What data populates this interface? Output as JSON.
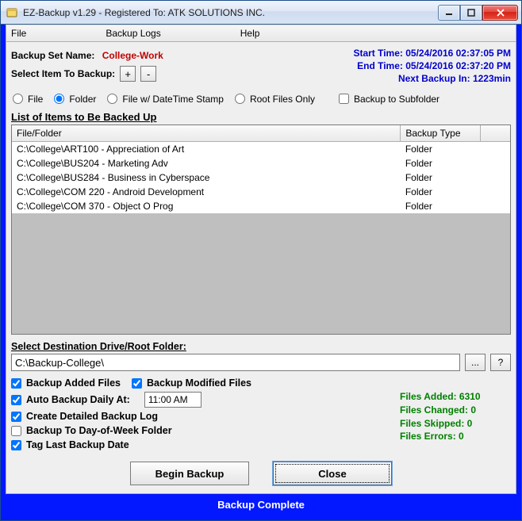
{
  "window": {
    "title": "EZ-Backup v1.29 - Registered To: ATK SOLUTIONS INC.",
    "icon": "app-icon",
    "buttons": {
      "min": "–",
      "max": "□",
      "close": "✕"
    }
  },
  "menu": {
    "file": "File",
    "logs": "Backup Logs",
    "help": "Help"
  },
  "header": {
    "setname_label": "Backup Set Name:",
    "setname_value": "College-Work",
    "select_label": "Select Item To Backup:",
    "plus": "+",
    "minus": "-",
    "start_label": "Start Time: 05/24/2016 02:37:05 PM",
    "end_label": "End Time: 05/24/2016 02:37:20 PM",
    "next_label": "Next Backup In: 1223min"
  },
  "radios": {
    "file": "File",
    "folder": "Folder",
    "file_dt": "File w/ DateTime Stamp",
    "root": "Root Files Only",
    "sub": "Backup to Subfolder"
  },
  "grid": {
    "title": "List of Items to Be Backed Up",
    "col1": "File/Folder",
    "col2": "Backup Type",
    "rows": [
      {
        "path": "C:\\College\\ART100 - Appreciation of Art",
        "type": "Folder"
      },
      {
        "path": "C:\\College\\BUS204 - Marketing Adv",
        "type": "Folder"
      },
      {
        "path": "C:\\College\\BUS284 - Business in Cyberspace",
        "type": "Folder"
      },
      {
        "path": "C:\\College\\COM 220 - Android Development",
        "type": "Folder"
      },
      {
        "path": "C:\\College\\COM 370 - Object O Prog",
        "type": "Folder"
      }
    ]
  },
  "dest": {
    "title": "Select Destination Drive/Root Folder:",
    "value": "C:\\Backup-College\\",
    "browse": "...",
    "help": "?"
  },
  "opts": {
    "added": "Backup Added Files",
    "modified": "Backup Modified Files",
    "auto": "Auto Backup Daily At:",
    "auto_time": "11:00 AM",
    "log": "Create Detailed Backup Log",
    "dow": "Backup To Day-of-Week Folder",
    "tag": "Tag Last Backup Date"
  },
  "stats": {
    "added": "Files Added: 6310",
    "changed": "Files Changed: 0",
    "skipped": "Files Skipped: 0",
    "errors": "Files Errors: 0"
  },
  "buttons": {
    "begin": "Begin Backup",
    "close": "Close"
  },
  "status": "Backup Complete"
}
